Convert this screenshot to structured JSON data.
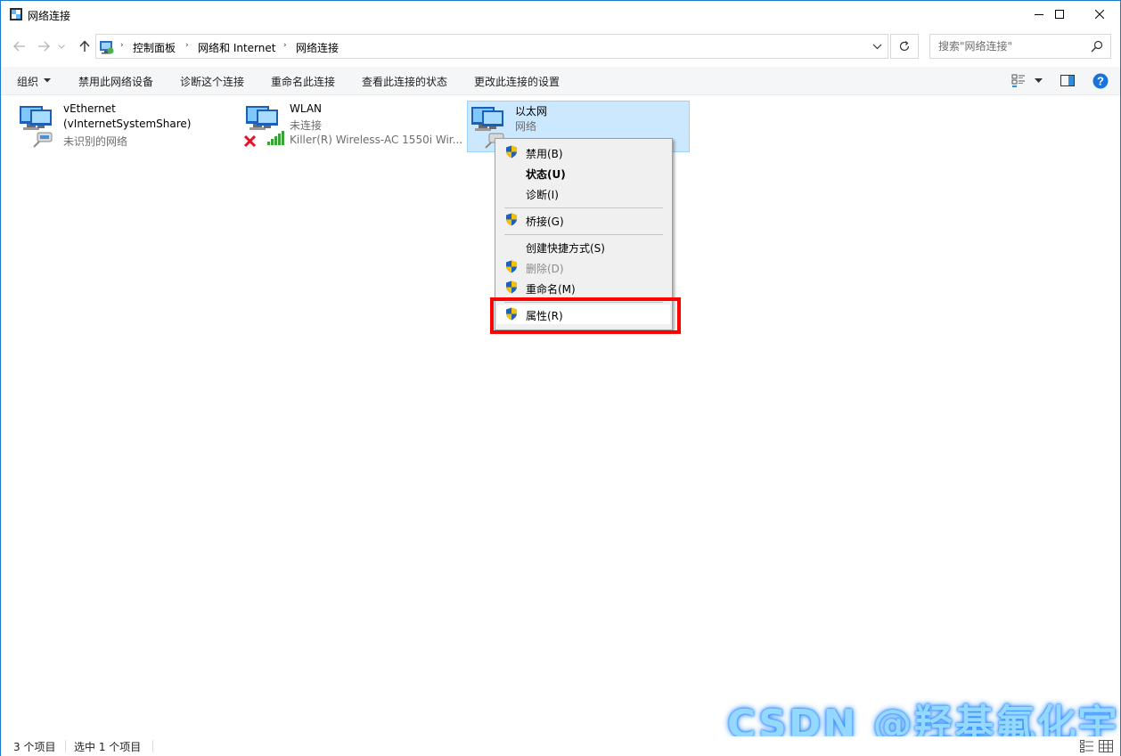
{
  "window": {
    "title": "网络连接"
  },
  "address_bar": {
    "crumbs": [
      "控制面板",
      "网络和 Internet",
      "网络连接"
    ],
    "search_placeholder": "搜索\"网络连接\""
  },
  "command_bar": {
    "items": [
      "组织",
      "禁用此网络设备",
      "诊断这个连接",
      "重命名此连接",
      "查看此连接的状态",
      "更改此连接的设置"
    ]
  },
  "connections": [
    {
      "name": "vEthernet",
      "line2": "(vInternetSystemShare)",
      "line3": "未识别的网络",
      "selected": false,
      "status_icon": "network-share-icon"
    },
    {
      "name": "WLAN",
      "line2": "未连接",
      "line3": "Killer(R) Wireless-AC 1550i Wir...",
      "selected": false,
      "status_icon": "disconnected-x-icon"
    },
    {
      "name": "以太网",
      "line2": "网络",
      "line3": "",
      "selected": true,
      "status_icon": "ethernet-cable-icon"
    }
  ],
  "context_menu": {
    "items": [
      {
        "label": "禁用(B)",
        "shield": true,
        "bold": false,
        "disabled": false
      },
      {
        "label": "状态(U)",
        "shield": false,
        "bold": true,
        "disabled": false
      },
      {
        "label": "诊断(I)",
        "shield": false,
        "bold": false,
        "disabled": false
      },
      {
        "label": "桥接(G)",
        "shield": true,
        "bold": false,
        "disabled": false
      },
      {
        "label": "创建快捷方式(S)",
        "shield": false,
        "bold": false,
        "disabled": false
      },
      {
        "label": "删除(D)",
        "shield": true,
        "bold": false,
        "disabled": true
      },
      {
        "label": "重命名(M)",
        "shield": true,
        "bold": false,
        "disabled": false
      },
      {
        "label": "属性(R)",
        "shield": true,
        "bold": false,
        "disabled": false,
        "highlighted": true
      }
    ]
  },
  "status_bar": {
    "count": "3 个项目",
    "selection": "选中 1 个项目"
  },
  "watermark": "CSDN @羟基氟化宇",
  "colors": {
    "accent_border": "#1979ca",
    "selection_bg": "#cce8ff",
    "selection_border": "#99d1ff",
    "highlight_box": "#ff0000",
    "shield_blue": "#1f5fbf",
    "shield_yellow": "#f2c200",
    "help_blue": "#1a73d9"
  }
}
